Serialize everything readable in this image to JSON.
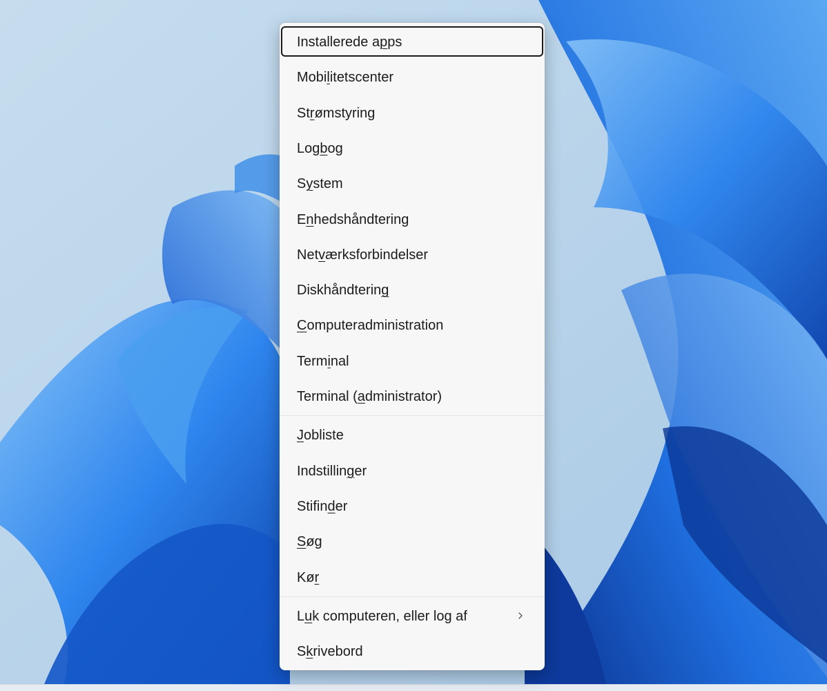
{
  "wallpaper": {
    "colors": [
      "#c4dbed",
      "#1f6fe0",
      "#0b3fa8",
      "#5aa7f2",
      "#86c2f7"
    ]
  },
  "menu": {
    "groups": [
      {
        "items": [
          {
            "pre": "Installerede a",
            "key": "p",
            "post": "ps",
            "focused": true
          },
          {
            "pre": "Mobi",
            "key": "l",
            "post": "itetscenter"
          },
          {
            "pre": "St",
            "key": "r",
            "post": "ømstyring"
          },
          {
            "pre": "Log",
            "key": "b",
            "post": "og"
          },
          {
            "pre": "S",
            "key": "y",
            "post": "stem"
          },
          {
            "pre": "E",
            "key": "n",
            "post": "hedshåndtering"
          },
          {
            "pre": "Net",
            "key": "v",
            "post": "ærksforbindelser"
          },
          {
            "pre": "Diskhåndterin",
            "key": "g",
            "post": ""
          },
          {
            "pre": "",
            "key": "C",
            "post": "omputeradministration"
          },
          {
            "pre": "Term",
            "key": "i",
            "post": "nal"
          },
          {
            "pre": "Terminal (",
            "key": "a",
            "post": "dministrator)"
          }
        ]
      },
      {
        "items": [
          {
            "pre": "",
            "key": "J",
            "post": "obliste"
          },
          {
            "pre": "Indstillin",
            "key": "g",
            "post": "er"
          },
          {
            "pre": "Stifin",
            "key": "d",
            "post": "er"
          },
          {
            "pre": "",
            "key": "S",
            "post": "øg"
          },
          {
            "pre": "Kø",
            "key": "r",
            "post": ""
          }
        ]
      },
      {
        "items": [
          {
            "pre": "L",
            "key": "u",
            "post": "k computeren, eller log af",
            "submenu": true,
            "icon": "chevron-right-icon"
          },
          {
            "pre": "S",
            "key": "k",
            "post": "rivebord"
          }
        ]
      }
    ]
  }
}
